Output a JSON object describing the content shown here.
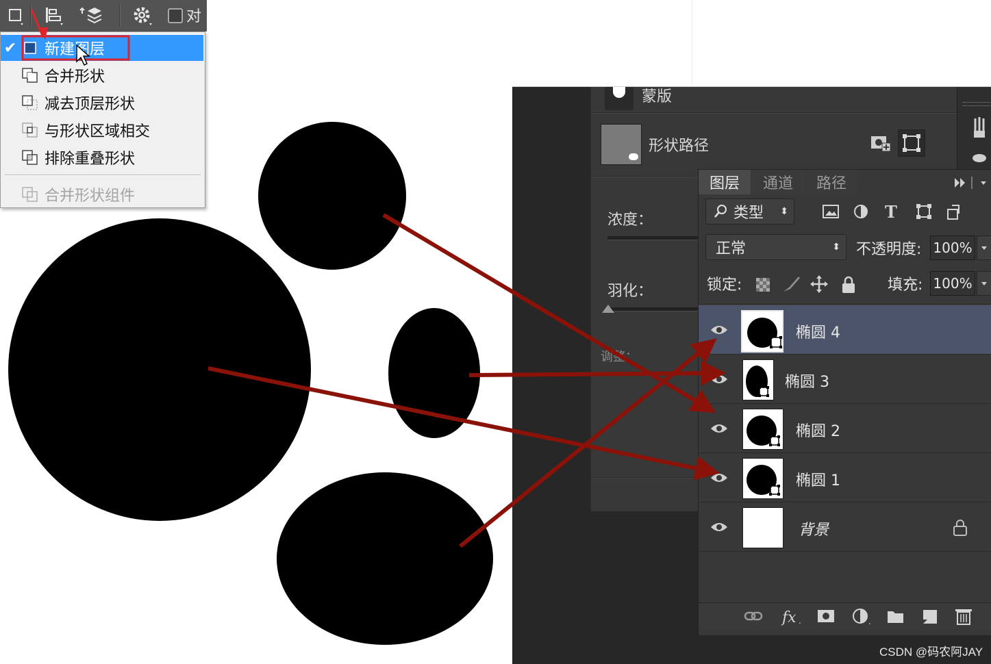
{
  "toolbar": {
    "align_label_partial": "对",
    "icons": [
      "path-operations-icon",
      "path-alignment-icon",
      "path-arrangement-icon",
      "gear-icon",
      "checkbox-icon"
    ]
  },
  "menu": {
    "items": [
      {
        "label": "新建图层",
        "checked": true,
        "icon": "new-layer-icon"
      },
      {
        "label": "合并形状",
        "checked": false,
        "icon": "combine-shapes-icon"
      },
      {
        "label": "减去顶层形状",
        "checked": false,
        "icon": "subtract-front-shape-icon"
      },
      {
        "label": "与形状区域相交",
        "checked": false,
        "icon": "intersect-shape-areas-icon"
      },
      {
        "label": "排除重叠形状",
        "checked": false,
        "icon": "exclude-overlapping-shapes-icon"
      }
    ],
    "disabled_item": {
      "label": "合并形状组件",
      "icon": "merge-shape-components-icon"
    }
  },
  "properties": {
    "mask_row_label": "蒙版",
    "vector_mask_label": "形状路径",
    "density_label": "浓度：",
    "feather_label": "羽化：",
    "adjust_label_partial": "调整："
  },
  "layers_panel": {
    "tabs": [
      "图层",
      "通道",
      "路径"
    ],
    "filter_kind": "类型",
    "blend_mode": "正常",
    "opacity_label": "不透明度:",
    "opacity_value": "100%",
    "lock_label": "锁定:",
    "fill_label": "填充:",
    "fill_value": "100%",
    "layers": [
      {
        "name": "椭圆 4",
        "selected": true,
        "type": "shape"
      },
      {
        "name": "椭圆 3",
        "selected": false,
        "type": "shape"
      },
      {
        "name": "椭圆 2",
        "selected": false,
        "type": "shape"
      },
      {
        "name": "椭圆 1",
        "selected": false,
        "type": "shape"
      },
      {
        "name": "背景",
        "selected": false,
        "type": "background",
        "locked": true
      }
    ],
    "bottom_icons": [
      "link-layers-icon",
      "fx-icon",
      "add-mask-icon",
      "adjustment-layer-icon",
      "group-folder-icon",
      "new-layer-icon",
      "trash-icon"
    ]
  },
  "colors": {
    "menu_highlight": "#3399ff",
    "highlight_box": "#e0242a",
    "arrow": "#8b1208",
    "panel_bg": "#383838",
    "selected_layer": "#4b5468"
  },
  "watermark": "CSDN @码农阿JAY"
}
